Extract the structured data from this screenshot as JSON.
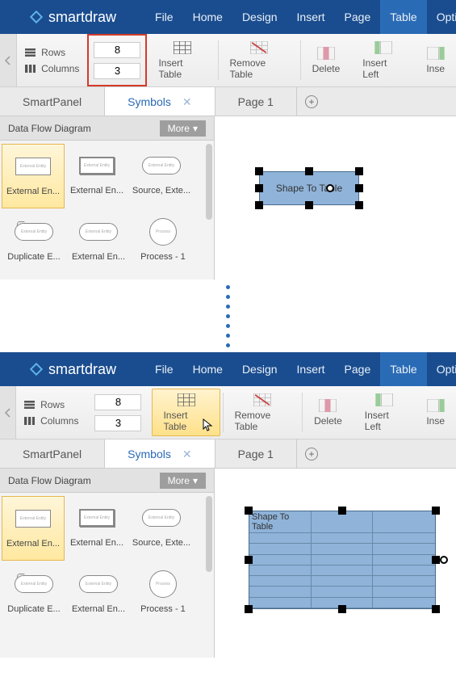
{
  "brand": "smartdraw",
  "menu": [
    "File",
    "Home",
    "Design",
    "Insert",
    "Page",
    "Table",
    "Option"
  ],
  "menu_active_index": 5,
  "ribbon": {
    "rows_label": "Rows",
    "columns_label": "Columns",
    "rows_value": "8",
    "columns_value": "3",
    "insert_table": "Insert Table",
    "remove_table": "Remove Table",
    "delete": "Delete",
    "insert_left": "Insert Left",
    "insert_extra": "Inse"
  },
  "tabs": {
    "smartpanel": "SmartPanel",
    "symbols": "Symbols",
    "page1": "Page 1"
  },
  "sidebar": {
    "title": "Data Flow Diagram",
    "more": "More",
    "shapes": [
      {
        "label": "External En...",
        "thumb": "rect",
        "tiny": "External Entity"
      },
      {
        "label": "External En...",
        "thumb": "rect-thick",
        "tiny": "External Entity"
      },
      {
        "label": "Source, Exte...",
        "thumb": "round",
        "tiny": "External Entity"
      },
      {
        "label": "Duplicate E...",
        "thumb": "round-dup",
        "tiny": "External Entity"
      },
      {
        "label": "External En...",
        "thumb": "round",
        "tiny": "External Entity"
      },
      {
        "label": "Process - 1",
        "thumb": "circle",
        "tiny": "Process"
      }
    ]
  },
  "canvas": {
    "shape_text_1": "Shape To Table",
    "shape_text_2": "Shape To Table"
  }
}
